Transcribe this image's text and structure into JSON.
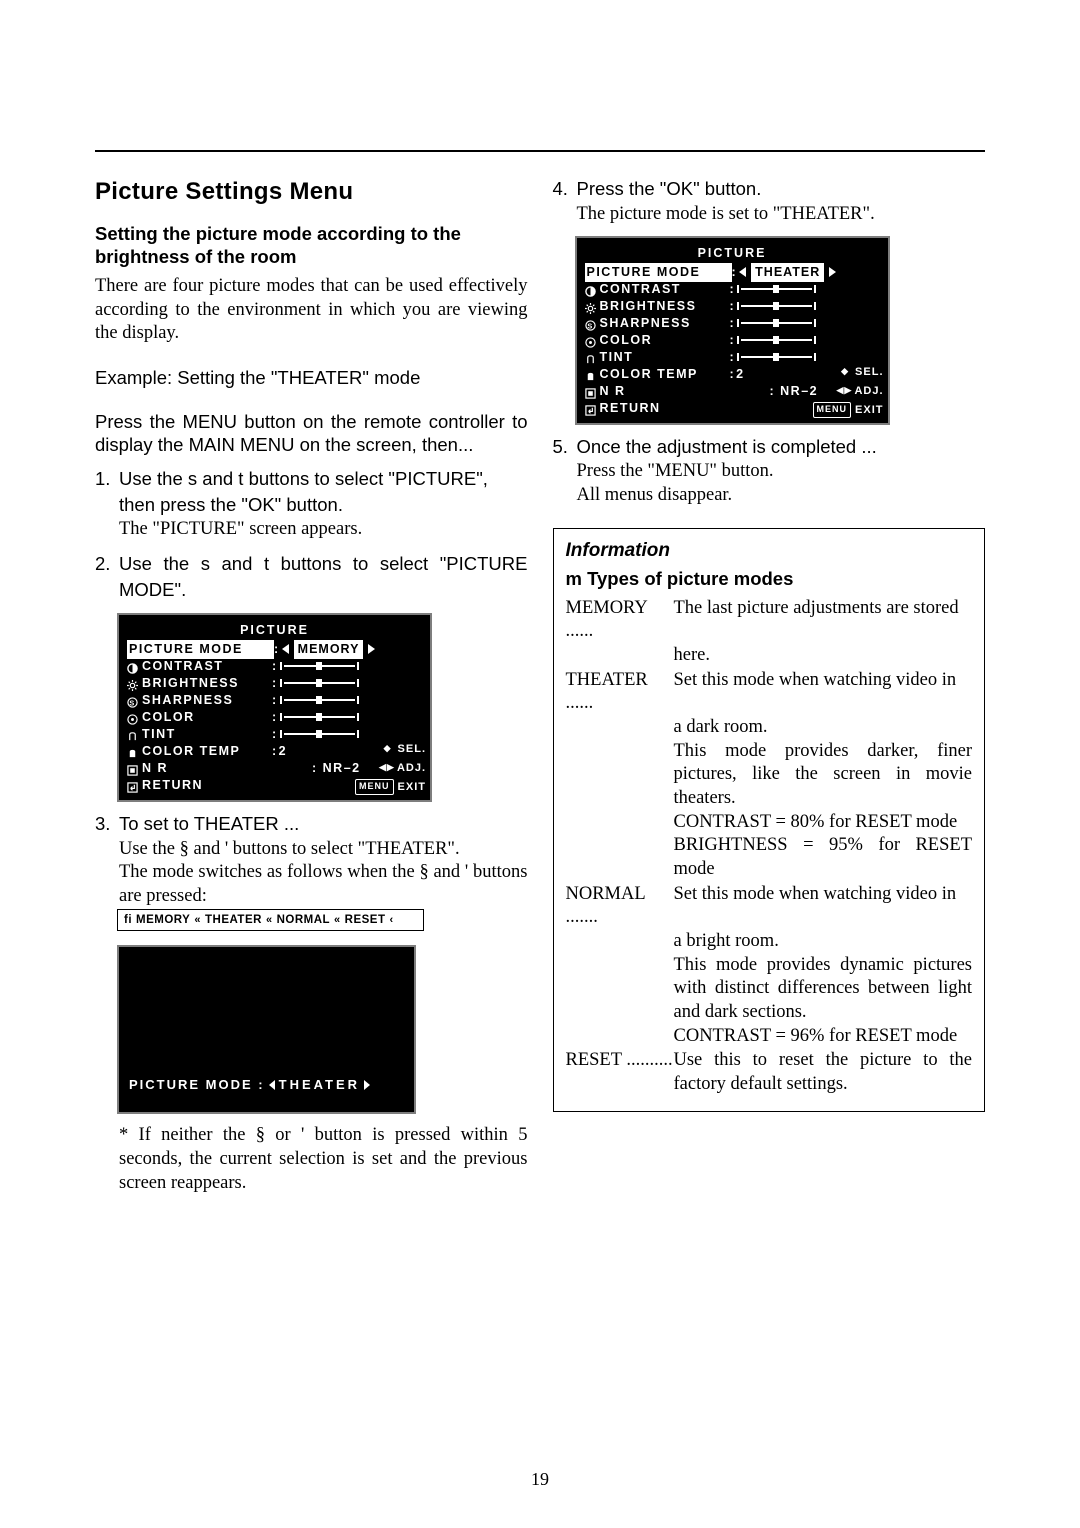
{
  "page_number": "19",
  "heading": "Picture Settings Menu",
  "intro_bold": "Setting the picture mode according to the brightness of the room",
  "intro_body": "There are four picture modes that can be used effectively according to the environment in which you are viewing the display.",
  "example_line": "Example: Setting the \"THEATER\" mode",
  "press_menu": "Press the MENU button on the remote controller to display the MAIN MENU on the screen, then...",
  "steps": {
    "s1_a": "Use the  s  and  t  buttons to select \"PICTURE\", then press the \"OK\" button.",
    "s1_b": "The \"PICTURE\" screen appears.",
    "s2": "Use the  s  and t  buttons to select \"PICTURE MODE\".",
    "s3_head": "To set to  THEATER  ...",
    "s3_a": "Use the  §  and  '  buttons to select \"THEATER\".",
    "s3_b": "The mode switches as follows when the  §  and  '  buttons are pressed:",
    "note": "* If neither the  §  or  '  button is pressed within 5 seconds, the current selection is set and the previous screen reappears.",
    "s4_a": "Press the \"OK\" button.",
    "s4_b": "The picture mode is set to \"THEATER\".",
    "s5_a": "Once the adjustment is completed ...",
    "s5_b": "Press the \"MENU\" button.",
    "s5_c": "All menus disappear."
  },
  "cycle": {
    "lead": "fi",
    "items": [
      "MEMORY",
      "THEATER",
      "NORMAL",
      "RESET"
    ],
    "sep": "«",
    "tail": "‹"
  },
  "osd": {
    "title": "PICTURE",
    "rows": {
      "picture_mode": "PICTURE MODE",
      "contrast": "CONTRAST",
      "brightness": "BRIGHTNESS",
      "sharpness": "SHARPNESS",
      "color": "COLOR",
      "tint": "TINT",
      "color_temp": "COLOR TEMP",
      "color_temp_val": "2",
      "nr": "N R",
      "nr_val": "NR–2",
      "return": "RETURN"
    },
    "mode_value_memory": "MEMORY",
    "mode_value_theater": "THEATER",
    "hints": {
      "sel": "SEL.",
      "adj": "ADJ.",
      "exit": "EXIT",
      "menu": "MENU"
    }
  },
  "theater_band": "PICTURE MODE :",
  "theater_band_value": "THEATER",
  "info": {
    "heading": "Information",
    "sub": "m Types of picture modes",
    "memory_key": "MEMORY ......",
    "memory_1": "The last picture adjustments are stored",
    "memory_2": "here.",
    "theater_key": "THEATER ......",
    "theater_1": "Set this mode when watching video in",
    "theater_2": "a dark room.",
    "theater_3": "This mode provides darker, finer pictures, like the screen in movie theaters.",
    "theater_4": "CONTRAST = 80% for RESET mode",
    "theater_5": "BRIGHTNESS = 95% for RESET mode",
    "normal_key": "NORMAL .......",
    "normal_1": "Set this mode when watching video in",
    "normal_2": "a bright room.",
    "normal_3": "This mode provides dynamic pictures with distinct differences between light and dark sections.",
    "normal_4": "CONTRAST = 96% for RESET mode",
    "reset_key": "RESET ..........",
    "reset_1": "Use this to reset the picture to the factory default settings."
  }
}
